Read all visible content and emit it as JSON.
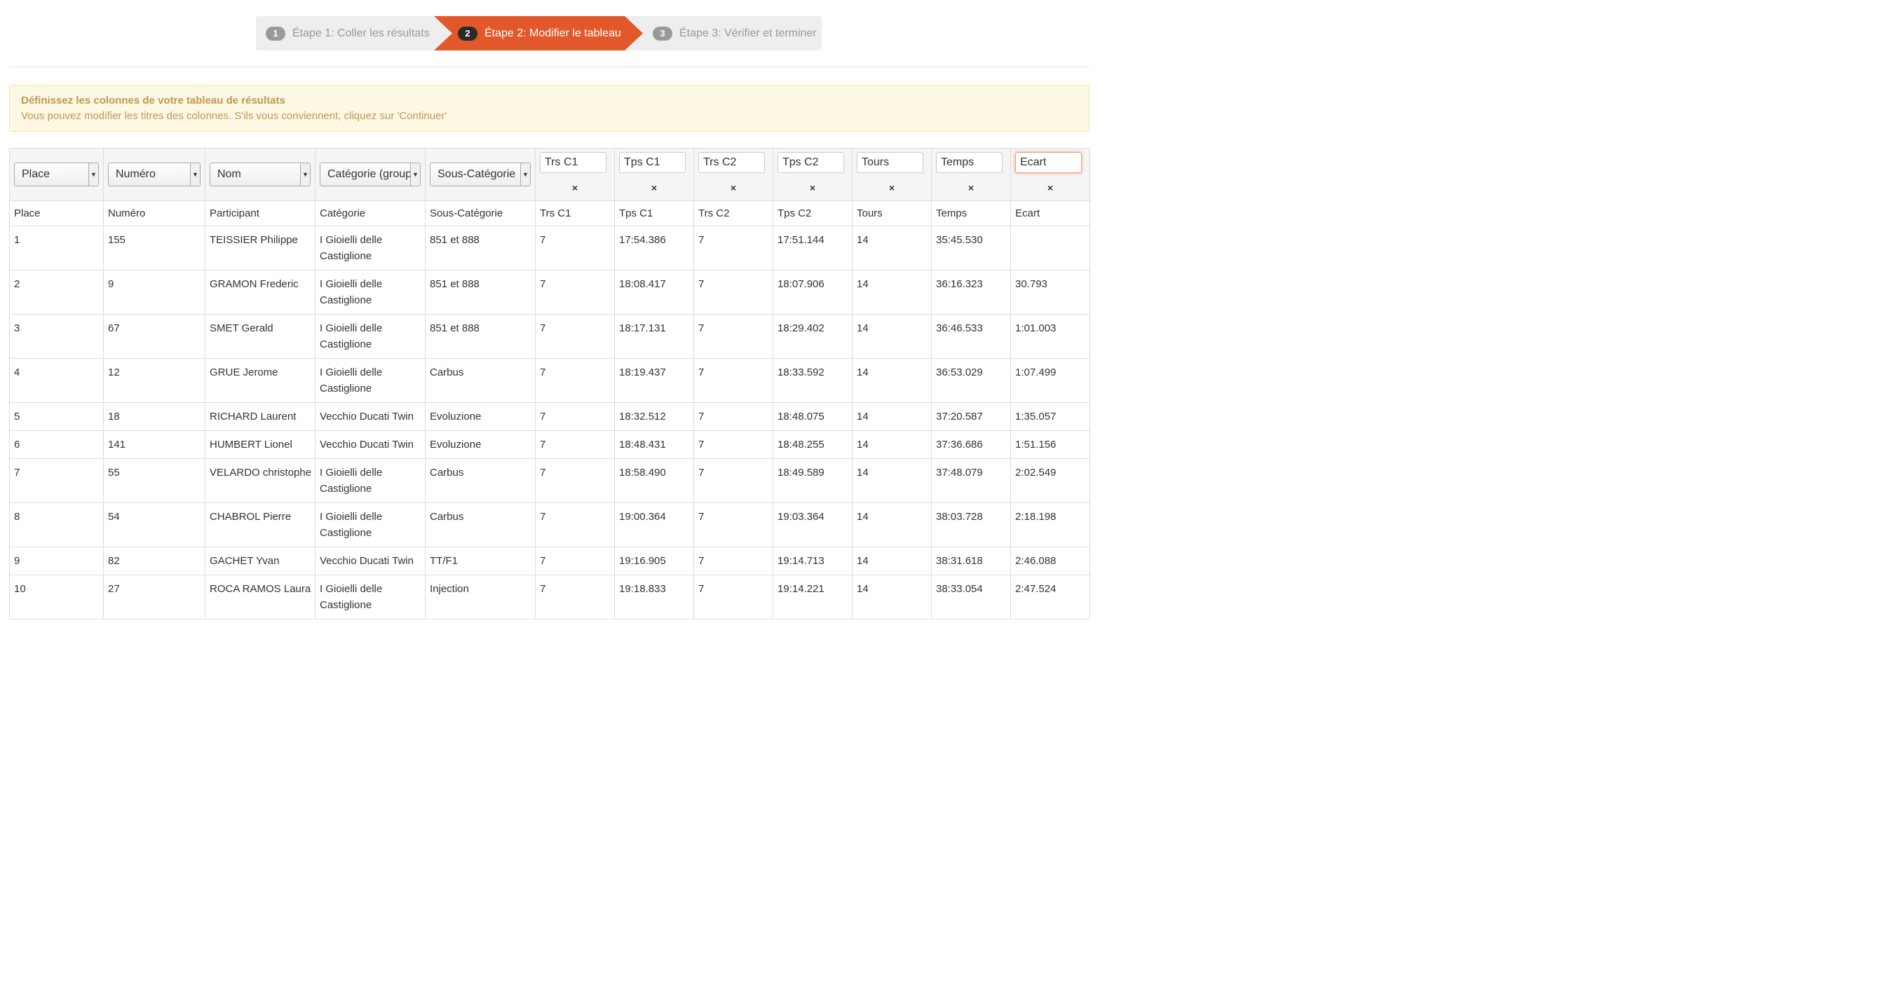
{
  "stepper": {
    "steps": [
      {
        "num": "1",
        "label": "Étape 1: Coller les résultats"
      },
      {
        "num": "2",
        "label": "Étape 2: Modifier le tableau"
      },
      {
        "num": "3",
        "label": "Étape 3: Vérifier et terminer"
      }
    ]
  },
  "alert": {
    "title": "Définissez les colonnes de votre tableau de résultats",
    "text": "Vous pouvez modifier les titres des colonnes. S'ils vous conviennent, cliquez sur 'Continuer'"
  },
  "column_selects": [
    "Place",
    "Numéro",
    "Nom",
    "Catégorie (groupe)",
    "Sous-Catégorie"
  ],
  "column_inputs": [
    "Trs C1",
    "Tps C1",
    "Trs C2",
    "Tps C2",
    "Tours",
    "Temps",
    "Ecart"
  ],
  "remove_symbol": "×",
  "headers": [
    "Place",
    "Numéro",
    "Participant",
    "Catégorie",
    "Sous-Catégorie",
    "Trs C1",
    "Tps C1",
    "Trs C2",
    "Tps C2",
    "Tours",
    "Temps",
    "Ecart"
  ],
  "rows": [
    [
      "1",
      "155",
      "TEISSIER Philippe",
      "I Gioielli delle Castiglione",
      "851 et 888",
      "7",
      "17:54.386",
      "7",
      "17:51.144",
      "14",
      "35:45.530",
      ""
    ],
    [
      "2",
      "9",
      "GRAMON Frederic",
      "I Gioielli delle Castiglione",
      "851 et 888",
      "7",
      "18:08.417",
      "7",
      "18:07.906",
      "14",
      "36:16.323",
      "30.793"
    ],
    [
      "3",
      "67",
      "SMET Gerald",
      "I Gioielli delle Castiglione",
      "851 et 888",
      "7",
      "18:17.131",
      "7",
      "18:29.402",
      "14",
      "36:46.533",
      "1:01.003"
    ],
    [
      "4",
      "12",
      "GRUE Jerome",
      "I Gioielli delle Castiglione",
      "Carbus",
      "7",
      "18:19.437",
      "7",
      "18:33.592",
      "14",
      "36:53.029",
      "1:07.499"
    ],
    [
      "5",
      "18",
      "RICHARD Laurent",
      "Vecchio Ducati Twin",
      "Evoluzione",
      "7",
      "18:32.512",
      "7",
      "18:48.075",
      "14",
      "37:20.587",
      "1:35.057"
    ],
    [
      "6",
      "141",
      "HUMBERT Lionel",
      "Vecchio Ducati Twin",
      "Evoluzione",
      "7",
      "18:48.431",
      "7",
      "18:48.255",
      "14",
      "37:36.686",
      "1:51.156"
    ],
    [
      "7",
      "55",
      "VELARDO christophe",
      "I Gioielli delle Castiglione",
      "Carbus",
      "7",
      "18:58.490",
      "7",
      "18:49.589",
      "14",
      "37:48.079",
      "2:02.549"
    ],
    [
      "8",
      "54",
      "CHABROL Pierre",
      "I Gioielli delle Castiglione",
      "Carbus",
      "7",
      "19:00.364",
      "7",
      "19:03.364",
      "14",
      "38:03.728",
      "2:18.198"
    ],
    [
      "9",
      "82",
      "GACHET Yvan",
      "Vecchio Ducati Twin",
      "TT/F1",
      "7",
      "19:16.905",
      "7",
      "19:14.713",
      "14",
      "38:31.618",
      "2:46.088"
    ],
    [
      "10",
      "27",
      "ROCA RAMOS Laura",
      "I Gioielli delle Castiglione",
      "Injection",
      "7",
      "19:18.833",
      "7",
      "19:14.221",
      "14",
      "38:33.054",
      "2:47.524"
    ]
  ]
}
